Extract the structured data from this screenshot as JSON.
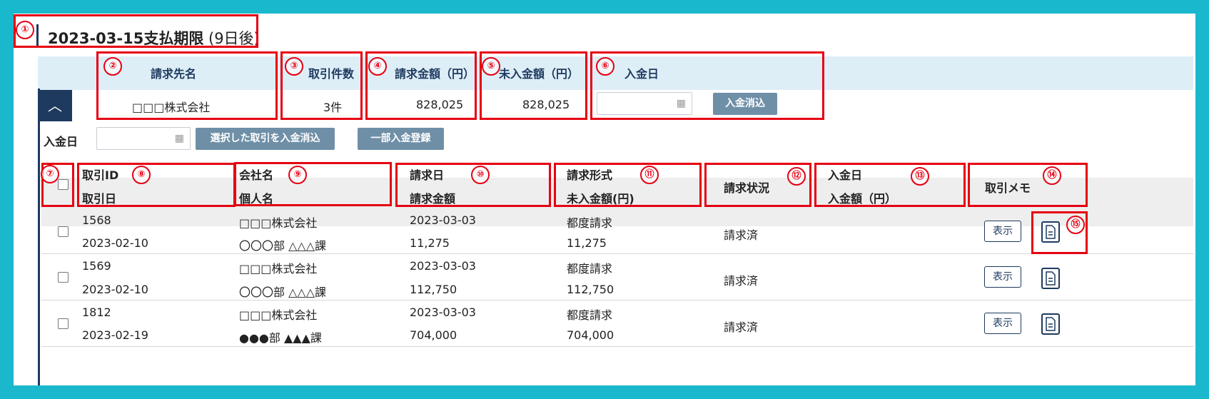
{
  "header": {
    "title_main": "2023-03-15支払期限",
    "title_sub": " (9日後)"
  },
  "summary": {
    "headers": {
      "billing_name": "請求先名",
      "count": "取引件数",
      "amount": "請求金額（円）",
      "unpaid": "未入金額（円）",
      "payment_date": "入金日"
    },
    "values": {
      "billing_name": "□□□株式会社",
      "count": "3件",
      "amount": "828,025",
      "unpaid": "828,025"
    },
    "clear_button": "入金消込",
    "collapse_icon": "︿"
  },
  "bulk": {
    "label": "入金日",
    "clear_selected": "選択した取引を入金消込",
    "partial_register": "一部入金登録"
  },
  "table": {
    "headers": {
      "id": "取引ID",
      "date": "取引日",
      "company": "会社名",
      "person": "個人名",
      "bill_date": "請求日",
      "bill_amount": "請求金額",
      "bill_type": "請求形式",
      "unpaid": "未入金額(円)",
      "status": "請求状況",
      "pay_date": "入金日",
      "pay_amount": "入金額（円）",
      "memo": "取引メモ"
    },
    "rows": [
      {
        "id": "1568",
        "date": "2023-02-10",
        "company": "□□□株式会社",
        "person": "〇〇〇部 △△△課",
        "bill_date": "2023-03-03",
        "bill_amount": "11,275",
        "bill_type": "都度請求",
        "unpaid": "11,275",
        "status": "請求済",
        "show": "表示"
      },
      {
        "id": "1569",
        "date": "2023-02-10",
        "company": "□□□株式会社",
        "person": "〇〇〇部 △△△課",
        "bill_date": "2023-03-03",
        "bill_amount": "112,750",
        "bill_type": "都度請求",
        "unpaid": "112,750",
        "status": "請求済",
        "show": "表示"
      },
      {
        "id": "1812",
        "date": "2023-02-19",
        "company": "□□□株式会社",
        "person": "●●●部 ▲▲▲課",
        "bill_date": "2023-03-03",
        "bill_amount": "704,000",
        "bill_type": "都度請求",
        "unpaid": "704,000",
        "status": "請求済",
        "show": "表示"
      }
    ]
  },
  "annotations": [
    "①",
    "②",
    "③",
    "④",
    "⑤",
    "⑥",
    "⑦",
    "⑧",
    "⑨",
    "⑩",
    "⑪",
    "⑫",
    "⑬",
    "⑭",
    "⑮"
  ],
  "colors": {
    "frame": "#1ab8cc",
    "navy": "#1e3a5f",
    "highlight": "#e60012",
    "summary_bg": "#deeef7",
    "button": "#6f8fa7"
  }
}
